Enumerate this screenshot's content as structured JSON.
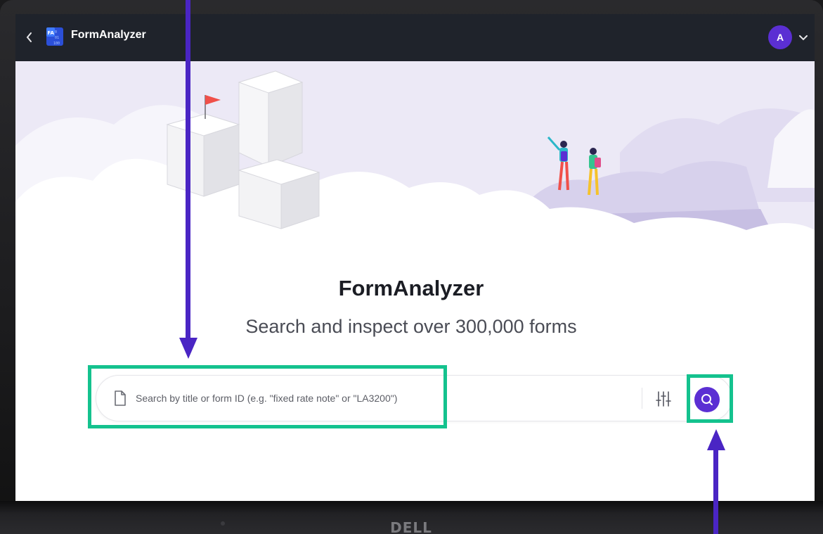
{
  "app": {
    "title": "FormAnalyzer",
    "avatar_initial": "A",
    "logo_text": "FA"
  },
  "main": {
    "title": "FormAnalyzer",
    "subtitle": "Search and inspect over 300,000 forms"
  },
  "search": {
    "placeholder": "Search by title or form ID (e.g. \"fixed rate note\" or \"LA3200\")",
    "value": ""
  },
  "device": {
    "brand": "DELL"
  },
  "colors": {
    "accent": "#5b2fd3",
    "header_bg": "#1f232b",
    "highlight": "#14c28e",
    "annotation_arrow": "#4a25c4",
    "hero_bg": "#ece9f6"
  },
  "icons": {
    "back": "chevron-left-icon",
    "document": "document-icon",
    "filter": "sliders-icon",
    "search": "search-icon",
    "avatar_menu": "chevron-down-icon"
  }
}
